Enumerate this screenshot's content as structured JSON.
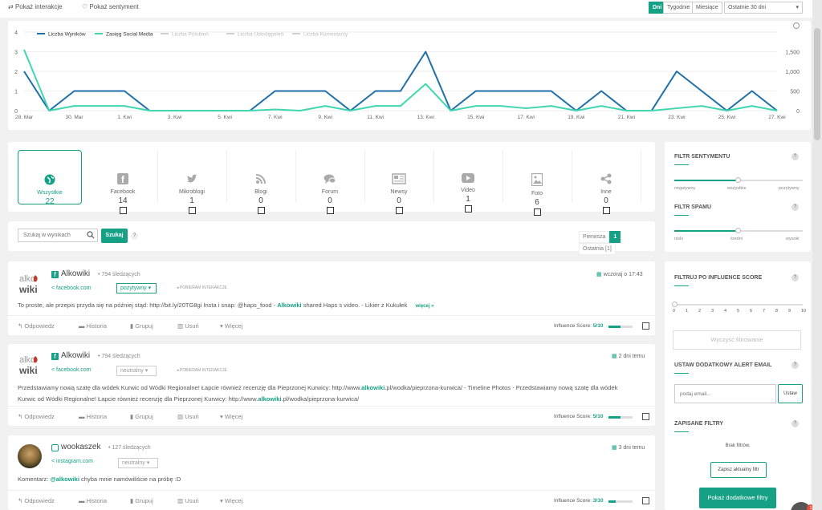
{
  "topbar": {
    "show_interactions": "Pokaż interakcje",
    "show_sentiment": "Pokaż sentyment",
    "period_buttons": [
      "Dni",
      "Tygodnie",
      "Miesiące"
    ],
    "range_select": "Ostatnie 30 dni"
  },
  "chart_data": {
    "type": "line",
    "legend": [
      "Liczba Wyników",
      "Zasięg Social Media",
      "Liczba Polubień",
      "Liczba Udostępnień",
      "Liczba Komentarzy"
    ],
    "x": [
      "28. Mar",
      "29. Mar",
      "30. Mar",
      "31. Mar",
      "1. Kwi",
      "2. Kwi",
      "3. Kwi",
      "4. Kwi",
      "5. Kwi",
      "6. Kwi",
      "7. Kwi",
      "8. Kwi",
      "9. Kwi",
      "10. Kwi",
      "11. Kwi",
      "12. Kwi",
      "13. Kwi",
      "14. Kwi",
      "15. Kwi",
      "16. Kwi",
      "17. Kwi",
      "18. Kwi",
      "19. Kwi",
      "20. Kwi",
      "21. Kwi",
      "22. Kwi",
      "23. Kwi",
      "24. Kwi",
      "25. Kwi",
      "26. Kwi",
      "27. Kwi"
    ],
    "x_tick_labels": [
      "28. Mar",
      "30. Mar",
      "1. Kwi",
      "3. Kwi",
      "5. Kwi",
      "7. Kwi",
      "9. Kwi",
      "11. Kwi",
      "13. Kwi",
      "15. Kwi",
      "17. Kwi",
      "19. Kwi",
      "21. Kwi",
      "23. Kwi",
      "25. Kwi",
      "27. Kwi"
    ],
    "y_left_ticks": [
      "0",
      "1",
      "2",
      "3",
      "4"
    ],
    "y_right_ticks": [
      "0",
      "500",
      "1,000",
      "1,500"
    ],
    "ylim_left": [
      0,
      4
    ],
    "ylim_right": [
      0,
      2000
    ],
    "series": [
      {
        "name": "Liczba Wyników",
        "color": "#1f6fa8",
        "axis": "left",
        "values": [
          2,
          0,
          1,
          1,
          1,
          0,
          0,
          0,
          0,
          0,
          1,
          1,
          1,
          0,
          1,
          1,
          3,
          0,
          1,
          1,
          1,
          1,
          0,
          1,
          0,
          0,
          2,
          1,
          0,
          1,
          0
        ]
      },
      {
        "name": "Zasięg Social Media",
        "color": "#3fd6b0",
        "axis": "right",
        "values": [
          1550,
          0,
          120,
          120,
          120,
          0,
          0,
          0,
          0,
          0,
          30,
          0,
          120,
          0,
          120,
          120,
          680,
          0,
          120,
          120,
          60,
          120,
          0,
          120,
          0,
          0,
          60,
          120,
          0,
          120,
          0
        ]
      }
    ]
  },
  "sources": [
    {
      "label": "Wszystkie",
      "count": "22",
      "icon": "globe-icon"
    },
    {
      "label": "Facebook",
      "count": "14",
      "icon": "facebook-icon"
    },
    {
      "label": "Mikroblogi",
      "count": "1",
      "icon": "twitter-icon"
    },
    {
      "label": "Blogi",
      "count": "0",
      "icon": "rss-icon"
    },
    {
      "label": "Forum",
      "count": "0",
      "icon": "forum-icon"
    },
    {
      "label": "Newsy",
      "count": "0",
      "icon": "news-icon"
    },
    {
      "label": "Video",
      "count": "1",
      "icon": "video-icon"
    },
    {
      "label": "Foto",
      "count": "6",
      "icon": "photo-icon"
    },
    {
      "label": "Inne",
      "count": "0",
      "icon": "share-icon"
    }
  ],
  "search": {
    "placeholder": "Szukaj w wynikach",
    "button": "Szukaj",
    "help": "?"
  },
  "pagination": {
    "first": "Pierwsza",
    "current": "1",
    "last": "Ostatnia [1]"
  },
  "posts": [
    {
      "author": "Alkowiki",
      "followers": "794 śledzących",
      "source": "facebook.com",
      "sentiment": "pozytywny",
      "download": "POBIERAM INTERAKCJE",
      "time": "wczoraj o 17:43",
      "text_before": "To proste, ale przepis przyda się na później stąd: http://bit.ly/20TG8gi Insta i snap: @haps_food - ",
      "text_bold": "Alkowiki",
      "text_after": " shared Haps s video. - Likier z Kukułek",
      "more": "więcej »",
      "score": "5/10",
      "score_value": 0.5
    },
    {
      "author": "Alkowiki",
      "followers": "794 śledzących",
      "source": "facebook.com",
      "sentiment": "neutralny",
      "download": "POBIERAM INTERAKCJE",
      "time": "2 dni temu",
      "line1_a": "Przedstawiamy nową szatę dla wódek Kurwic od Wódki Regionalne! Łapcie również recenzję dla Pieprzonej Kurwicy: http://www.",
      "line1_b": "alkowiki",
      "line1_c": ".pl/wodka/pieprzona-kurwica/ - Timeline Photos - Przedstawiamy nową szatę dla wódek",
      "line2_a": "Kurwic od Wódki Regionalne! Łapcie również recenzję dla Pieprzonej Kurwicy: http://www.",
      "line2_b": "alkowiki",
      "line2_c": ".pl/wodka/pieprzona-kurwica/",
      "score": "5/10",
      "score_value": 0.5
    },
    {
      "author": "wookaszek",
      "followers": "127 śledzących",
      "source": "instagram.com",
      "sentiment": "neutralny",
      "time": "3 dni temu",
      "text_before": "Komentarz: ",
      "text_bold": "@alkowiki",
      "text_after": " chyba mnie namówiliście na próbę :D",
      "score": "3/10",
      "score_value": 0.3
    }
  ],
  "post_actions": {
    "reply": "Odpowiedz",
    "history": "Historia",
    "group": "Grupuj",
    "delete": "Usuń",
    "more": "Więcej",
    "influence": "Influence Score:"
  },
  "sidebar": {
    "sentiment": {
      "title": "FILTR SENTYMENTU",
      "labels": [
        "negatywny",
        "wszystkie",
        "pozytywny"
      ],
      "value": 0.5
    },
    "spam": {
      "title": "FILTR SPAMU",
      "labels": [
        "niski",
        "średni",
        "wysoki"
      ],
      "value": 0.5
    },
    "influence": {
      "title": "FILTRUJ PO INFLUENCE SCORE",
      "ticks": [
        "0",
        "1",
        "2",
        "3",
        "4",
        "5",
        "6",
        "7",
        "8",
        "9",
        "10"
      ],
      "value": 0
    },
    "clear_button": "Wyczyść filtrowanie",
    "alert": {
      "title": "USTAW DODATKOWY ALERT EMAIL",
      "placeholder": "podaj email...",
      "button": "Ustaw"
    },
    "saved": {
      "title": "ZAPISANE FILTRY",
      "empty": "Brak filtrów.",
      "save_button": "Zapisz aktualny filtr"
    },
    "more_filters": "Pokaż dodatkowe filtry"
  },
  "notification_badge": "1"
}
